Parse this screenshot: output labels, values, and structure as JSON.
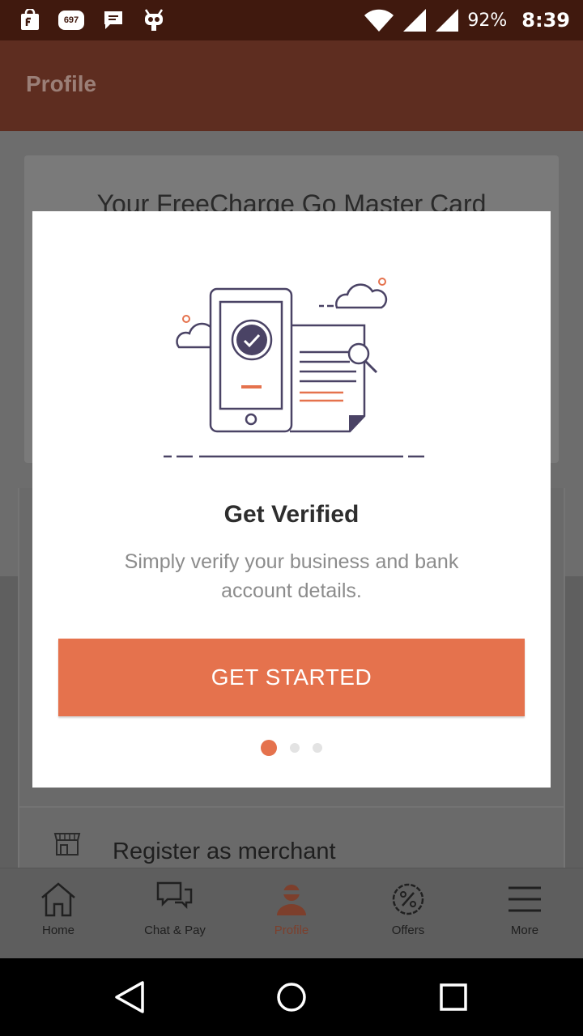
{
  "status_bar": {
    "notification_badge": "697",
    "battery": "92%",
    "time": "8:39",
    "icons": [
      "shopping-bag-icon",
      "notification-badge-icon",
      "message-icon",
      "robot-icon",
      "wifi-icon",
      "signal-icon",
      "signal-icon"
    ]
  },
  "app_bar": {
    "title": "Profile"
  },
  "background": {
    "card_title": "Your FreeCharge Go Master Card",
    "merchant_label": "Register as merchant"
  },
  "dialog": {
    "title": "Get Verified",
    "description": "Simply verify your business and bank account details.",
    "button_label": "GET STARTED",
    "page_count": 3,
    "active_page": 1,
    "illustration": "phone-verification-illustration"
  },
  "bottom_nav": {
    "items": [
      {
        "label": "Home",
        "icon": "home-icon"
      },
      {
        "label": "Chat & Pay",
        "icon": "chat-icon"
      },
      {
        "label": "Profile",
        "icon": "profile-icon"
      },
      {
        "label": "Offers",
        "icon": "offers-icon"
      },
      {
        "label": "More",
        "icon": "menu-icon"
      }
    ],
    "active_index": 2
  },
  "system_nav": {
    "buttons": [
      "back-icon",
      "home-circle-icon",
      "recents-icon"
    ]
  },
  "colors": {
    "accent": "#e5724d",
    "status_bar": "#40190e",
    "app_bar": "#5e2d20",
    "scrim": "#000000"
  }
}
